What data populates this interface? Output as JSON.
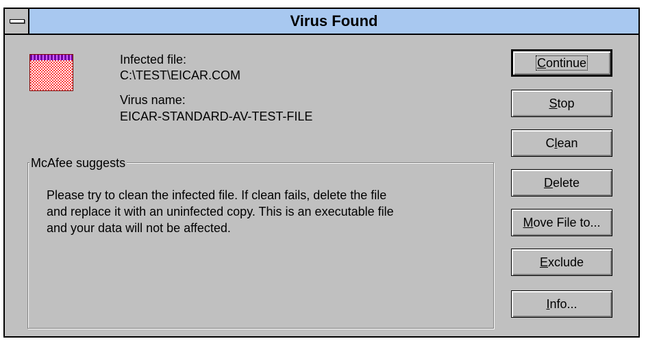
{
  "window": {
    "title": "Virus Found"
  },
  "info": {
    "infected_file_label": "Infected file:",
    "infected_file_value": "C:\\TEST\\EICAR.COM",
    "virus_name_label": "Virus name:",
    "virus_name_value": "EICAR-STANDARD-AV-TEST-FILE"
  },
  "suggestion": {
    "legend": "McAfee suggests",
    "lines": [
      "Please try to clean the infected file. If clean fails, delete the file",
      "and replace it with an uninfected copy. This is an executable file",
      "and your data will not be affected."
    ]
  },
  "buttons": [
    {
      "before": "",
      "mnemonic": "C",
      "after": "ontinue"
    },
    {
      "before": "",
      "mnemonic": "S",
      "after": "top"
    },
    {
      "before": "C",
      "mnemonic": "l",
      "after": "ean"
    },
    {
      "before": "",
      "mnemonic": "D",
      "after": "elete"
    },
    {
      "before": "",
      "mnemonic": "M",
      "after": "ove File to..."
    },
    {
      "before": "",
      "mnemonic": "E",
      "after": "xclude"
    },
    {
      "before": "",
      "mnemonic": "I",
      "after": "nfo..."
    }
  ],
  "icons": {
    "system_menu": "system-menu-icon",
    "virus": "virus-file-icon"
  },
  "colors": {
    "titlebar": "#a8c8f0",
    "dialog_face": "#c0c0c0",
    "icon_red": "#ff4040",
    "icon_purple": "#7000a0"
  }
}
